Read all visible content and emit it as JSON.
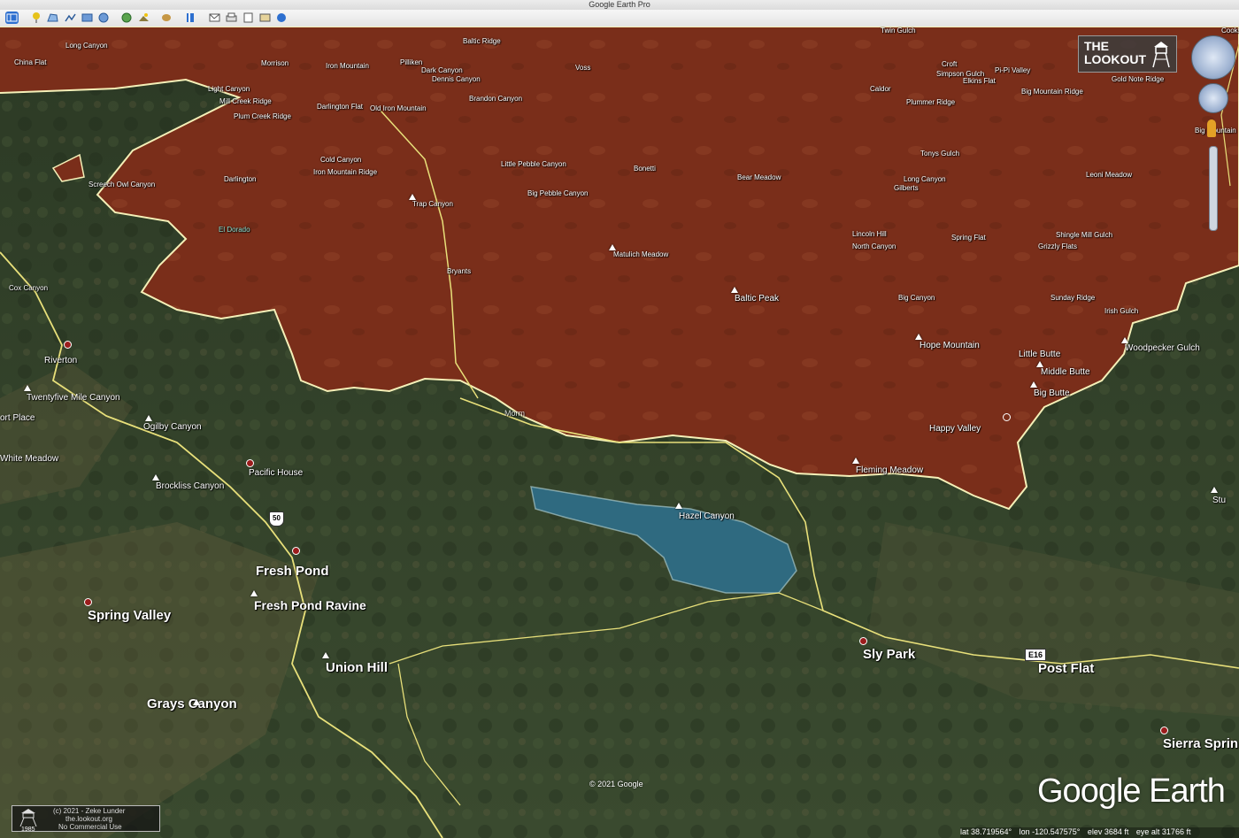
{
  "app": {
    "title": "Google Earth Pro"
  },
  "toolbar": {
    "icons": [
      "sidebar-icon",
      "placemark-icon",
      "polygon-icon",
      "path-icon",
      "overlay-icon",
      "tour-icon",
      "historical-imagery-icon",
      "sun-icon",
      "planets-icon",
      "ruler-icon",
      "email-icon",
      "print-icon",
      "save-image-icon",
      "map-view-icon",
      "google-maps-icon"
    ]
  },
  "overlay": {
    "lookout_line1": "THE",
    "lookout_line2": "LOOKOUT"
  },
  "labels_small": [
    "Long Canyon",
    "China Flat",
    "Morrison",
    "Iron Mountain",
    "Pilliken",
    "Baltic Ridge",
    "Dark Canyon",
    "Dennis Canyon",
    "Voss",
    "Twin Gulch",
    "Cooks",
    "Brandon Canyon",
    "Light Canyon",
    "Mill Creek Ridge",
    "Plum Creek Ridge",
    "Darlington Flat",
    "Old Iron Mountain",
    "Caldor",
    "Simpson Gulch",
    "Croft",
    "Elkins Flat",
    "Pi-Pi Valley",
    "Gold Note Ridge",
    "Big Mountain Ridge",
    "Plummer Ridge",
    "Big Mountain",
    "Cold Canyon",
    "Iron Mountain Ridge",
    "Darlington",
    "Screech Owl Canyon",
    "El Dorado",
    "Little Pebble Canyon",
    "Bonetti",
    "Big Pebble Canyon",
    "Bear Meadow",
    "Long Canyon",
    "Gilberts",
    "Tonys Gulch",
    "Leoni Meadow",
    "Trap Canyon",
    "Lincoln Hill",
    "North Canyon",
    "Spring Flat",
    "Shingle Mill Gulch",
    "Grizzly Flats",
    "Matulich Meadow",
    "Cox Canyon",
    "Bryants",
    "Baltic Peak",
    "Big Canyon",
    "Sunday Ridge",
    "Irish Gulch"
  ],
  "labels_medium": [
    "Riverton",
    "Twentyfive Mile Canyon",
    "ort Place",
    "Ogilby Canyon",
    "White Meadow",
    "Brockliss Canyon",
    "Pacific House",
    "Hope Mountain",
    "Little Butte",
    "Middle Butte",
    "Big Butte",
    "Woodpecker Gulch",
    "Happy Valley",
    "Fleming Meadow",
    "Hazel Canyon",
    "Morm",
    "Stu"
  ],
  "labels_large": [
    "Fresh Pond",
    "Fresh Pond Ravine",
    "Spring Valley",
    "Union Hill",
    "Grays Canyon",
    "Sly Park",
    "Post Flat",
    "Sierra Sprin"
  ],
  "roads": {
    "us50": "50",
    "e16": "E16"
  },
  "footer": {
    "copyright": "© 2021 Google",
    "brand": "Google Earth",
    "watermark_line1": "(c) 2021 - Zeke Lunder",
    "watermark_line2": "the.lookout.org",
    "watermark_line3": "No Commercial Use",
    "year": "1985",
    "lat": "lat  38.719564°",
    "lon": "lon -120.547575°",
    "elev": "elev  3684 ft",
    "eye_alt": "eye alt  31766 ft"
  },
  "colors": {
    "burn": "#7a2e1a",
    "perimeter": "#f5f0b8",
    "lake": "#2f6a80",
    "forest": "#2f3d26"
  }
}
